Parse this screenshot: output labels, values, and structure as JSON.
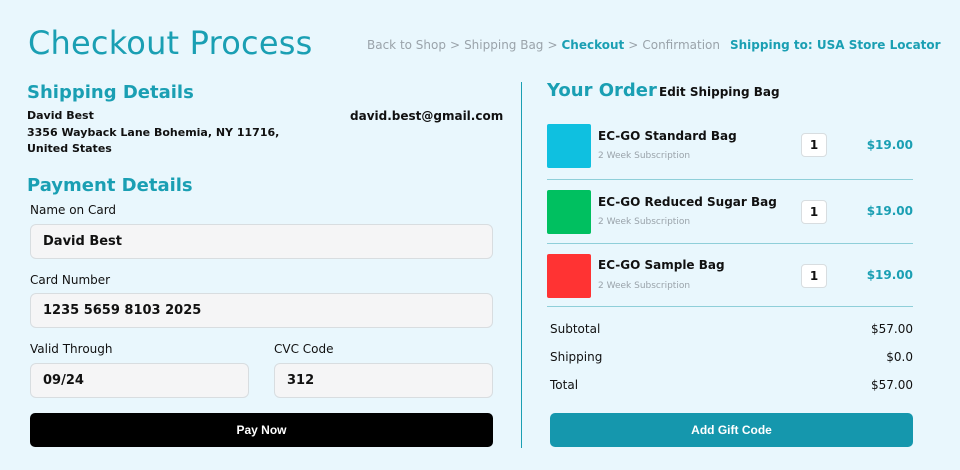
{
  "header": {
    "title": "Checkout Process",
    "breadcrumbs": [
      "Back to Shop",
      "Shipping Bag",
      "Checkout",
      "Confirmation"
    ],
    "breadcrumb_separator": ">",
    "shipping_link": "Shipping to: USA Store Locator"
  },
  "shipping": {
    "title": "Shipping Details",
    "name": "David Best",
    "address": "3356 Wayback Lane Bohemia, NY 11716, United States",
    "email": "david.best@gmail.com"
  },
  "payment": {
    "title": "Payment Details",
    "name_label": "Name on Card",
    "name_value": "David Best",
    "card_label": "Card Number",
    "card_value": "1235 5659 8103 2025",
    "valid_label": "Valid Through",
    "valid_value": "09/24",
    "cvc_label": "CVC Code",
    "cvc_value": "312",
    "pay_button": "Pay Now"
  },
  "order": {
    "title": "Your Order",
    "edit_link": "Edit Shipping Bag",
    "items": [
      {
        "name": "EC-GO Standard Bag",
        "subtitle": "2 Week Subscription",
        "qty": "1",
        "price": "$19.00",
        "color": "#0fc0e0"
      },
      {
        "name": "EC-GO Reduced Sugar Bag",
        "subtitle": "2 Week Subscription",
        "qty": "1",
        "price": "$19.00",
        "color": "#00c060"
      },
      {
        "name": "EC-GO Sample Bag",
        "subtitle": "2 Week Subscription",
        "qty": "1",
        "price": "$19.00",
        "color": "#ff3333"
      }
    ],
    "subtotal_label": "Subtotal",
    "subtotal_value": "$57.00",
    "shipping_label": "Shipping",
    "shipping_value": "$0.0",
    "total_label": "Total",
    "total_value": "$57.00",
    "gift_button": "Add Gift Code"
  },
  "colors": {
    "accent": "#1a9fb3",
    "background": "#e9f7fd",
    "pay_button": "#000000",
    "gift_button": "#1597ad"
  }
}
